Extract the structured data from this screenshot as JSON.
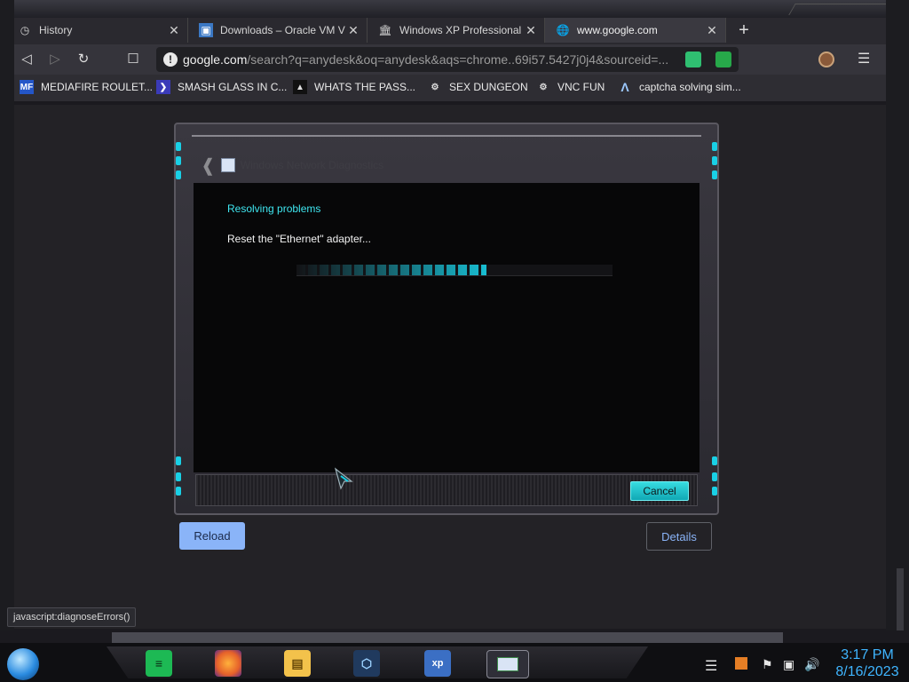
{
  "browser": {
    "tabs": [
      {
        "label": "History",
        "icon": "history-icon"
      },
      {
        "label": "Downloads – Oracle VM Vi",
        "icon": "virtualbox-icon"
      },
      {
        "label": "Windows XP Professional S",
        "icon": "archive-icon"
      },
      {
        "label": "www.google.com",
        "icon": "globe-icon",
        "active": true
      }
    ],
    "address": {
      "host": "google.com",
      "path": "/search?q=anydesk&oq=anydesk&aqs=chrome..69i57.5427j0j4&sourceid=..."
    },
    "bookmarks": [
      {
        "label": "MEDIAFIRE ROULET...",
        "icon": "mediafire-icon"
      },
      {
        "label": "SMASH GLASS IN C...",
        "icon": "smash-icon"
      },
      {
        "label": "WHATS THE PASS...",
        "icon": "lock-icon"
      },
      {
        "label": "SEX DUNGEON",
        "icon": "dungeon-icon"
      },
      {
        "label": "VNC FUN",
        "icon": "vnc-icon"
      },
      {
        "label": "captcha solving sim...",
        "icon": "captcha-icon"
      }
    ]
  },
  "dialog": {
    "title": "Windows Network Diagnostics",
    "heading": "Resolving problems",
    "status": "Reset the \"Ethernet\" adapter...",
    "progress": 0.6,
    "cancel_label": "Cancel"
  },
  "page": {
    "reload_label": "Reload",
    "details_label": "Details",
    "status_url": "javascript:diagnoseErrors()"
  },
  "taskbar": {
    "time": "3:17 PM",
    "date": "8/16/2023"
  },
  "colors": {
    "accent_cyan": "#19d0e6",
    "link_blue": "#8ab4f8",
    "clock_blue": "#3fb5ff"
  }
}
